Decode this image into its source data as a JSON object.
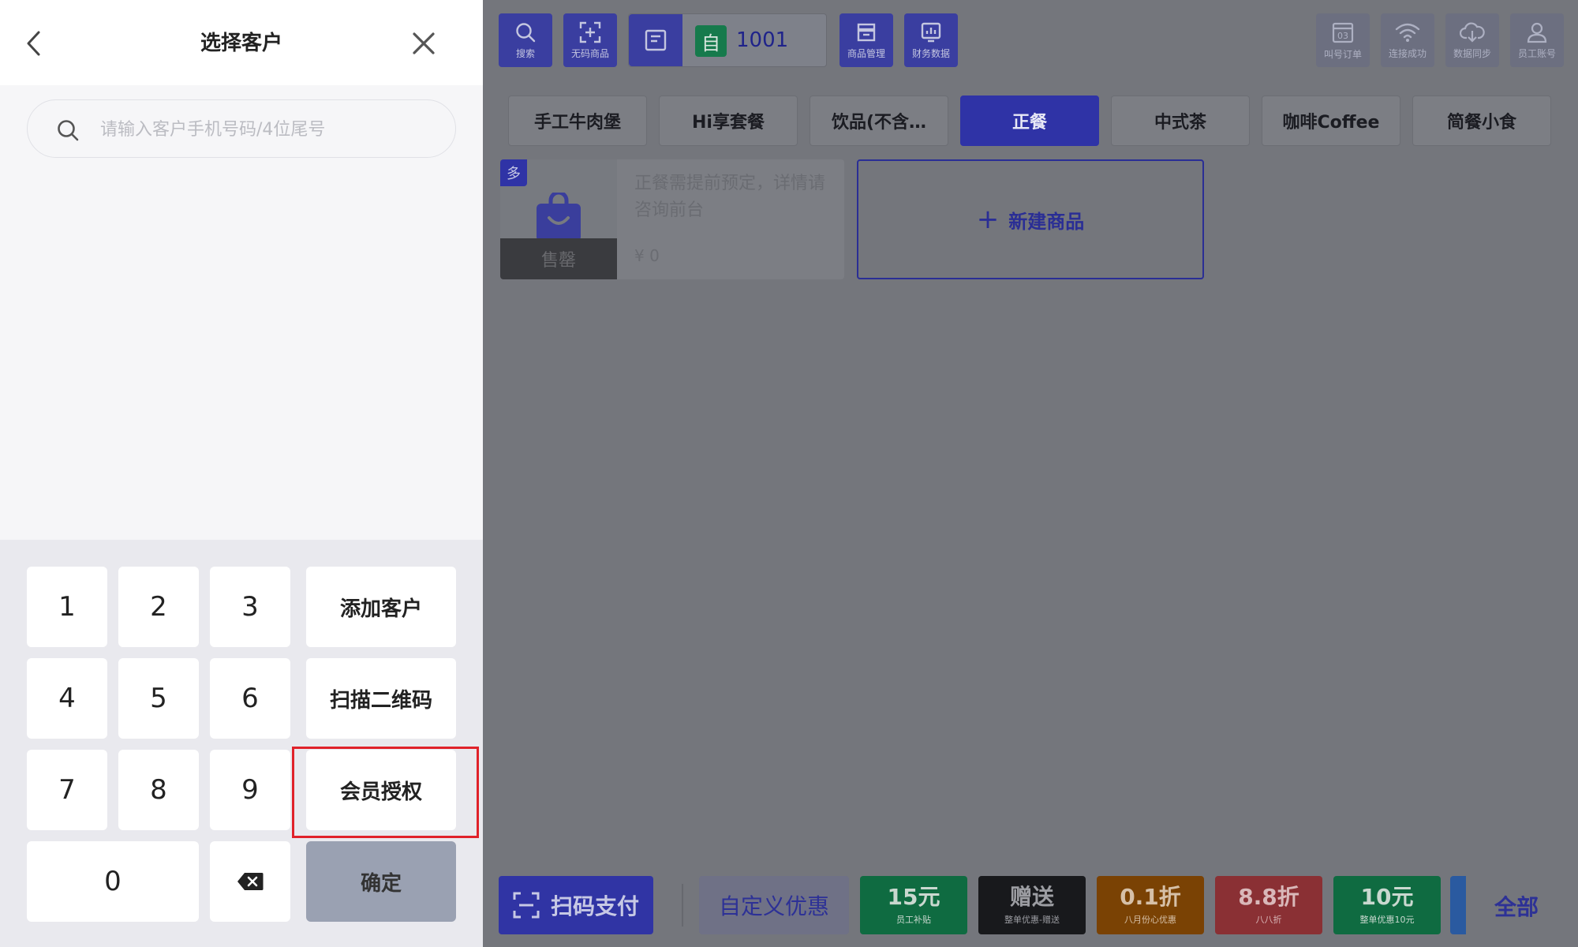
{
  "left_panel": {
    "title": "选择客户",
    "back_icon": "chevron-left-icon",
    "close_icon": "close-icon",
    "search": {
      "placeholder": "请输入客户手机号码/4位尾号",
      "value": ""
    },
    "keypad": {
      "digits": [
        "1",
        "2",
        "3",
        "4",
        "5",
        "6",
        "7",
        "8",
        "9",
        "0"
      ],
      "add_customer": "添加客户",
      "scan_qr": "扫描二维码",
      "member_auth": "会员授权",
      "confirm": "确定",
      "backspace_icon": "backspace-icon"
    },
    "highlight_color": "#e0222a"
  },
  "toolbar": {
    "search": "搜索",
    "no_code_item": "无码商品",
    "order_tag": "自",
    "order_number": "1001",
    "goods_mgmt": "商品管理",
    "finance": "财务数据",
    "call_order": "叫号订单",
    "call_order_badge": "03",
    "connected": "连接成功",
    "data_sync": "数据同步",
    "staff_account": "员工账号"
  },
  "categories": [
    {
      "label": "手工牛肉堡",
      "active": false
    },
    {
      "label": "Hi享套餐",
      "active": false
    },
    {
      "label": "饮品(不含…",
      "active": false
    },
    {
      "label": "正餐",
      "active": true
    },
    {
      "label": "中式茶",
      "active": false
    },
    {
      "label": "咖啡Coffee",
      "active": false
    },
    {
      "label": "简餐小食",
      "active": false
    }
  ],
  "product": {
    "badge": "多",
    "name": "正餐需提前预定，详情请咨询前台",
    "price": "¥ 0",
    "sold_out": "售罄"
  },
  "new_product": "新建商品",
  "bottom_bar": {
    "scan_pay": "扫码支付",
    "custom_discount": "自定义优惠",
    "discounts": [
      {
        "big": "15元",
        "small": "员工补贴",
        "bg": "#0f6b41",
        "fg": "#c9d8cf"
      },
      {
        "big": "赠送",
        "small": "整单优惠-赠送",
        "bg": "#18191c",
        "fg": "#9c9da2"
      },
      {
        "big": "0.1折",
        "small": "八月份心优惠",
        "bg": "#7a4204",
        "fg": "#d6c0a8"
      },
      {
        "big": "8.8折",
        "small": "八八折",
        "bg": "#8a3034",
        "fg": "#d9b8b9"
      },
      {
        "big": "10元",
        "small": "整单优惠10元",
        "bg": "#0f6b41",
        "fg": "#c9d8cf"
      }
    ],
    "all": "全部"
  },
  "colors": {
    "primary": "#3a3ea0",
    "overlay_bg": "#74767c"
  }
}
